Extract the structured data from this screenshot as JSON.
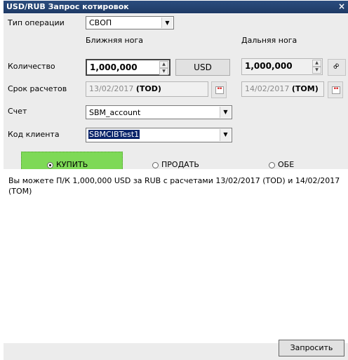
{
  "window": {
    "title": "USD/RUB Запрос котировок",
    "close_label": "×"
  },
  "labels": {
    "operation_type": "Тип операции",
    "near_leg": "Ближняя нога",
    "far_leg": "Дальняя нога",
    "quantity": "Количество",
    "settlement": "Срок расчетов",
    "account": "Счет",
    "client_code": "Код клиента"
  },
  "operation_type": {
    "value": "СВОП"
  },
  "near": {
    "amount": "1,000,000",
    "date": "13/02/2017",
    "tenor": "(TOD)"
  },
  "far": {
    "amount": "1,000,000",
    "date": "14/02/2017",
    "tenor": "(TOM)"
  },
  "currency_button": "USD",
  "account": {
    "value": "SBM_account"
  },
  "client": {
    "value": "SBMCIBTest1"
  },
  "sides": {
    "buy": "КУПИТЬ",
    "sell": "ПРОДАТЬ",
    "both": "ОБЕ",
    "selected": "buy"
  },
  "message": "Вы можете П/К 1,000,000 USD за RUB с расчетами 13/02/2017 (TOD) и 14/02/2017 (TOM)",
  "request_button": "Запросить",
  "colors": {
    "title_bg": "#1f3b66",
    "buy_active": "#7ed957"
  },
  "icons": {
    "link": "link-icon",
    "calendar": "calendar-icon"
  }
}
